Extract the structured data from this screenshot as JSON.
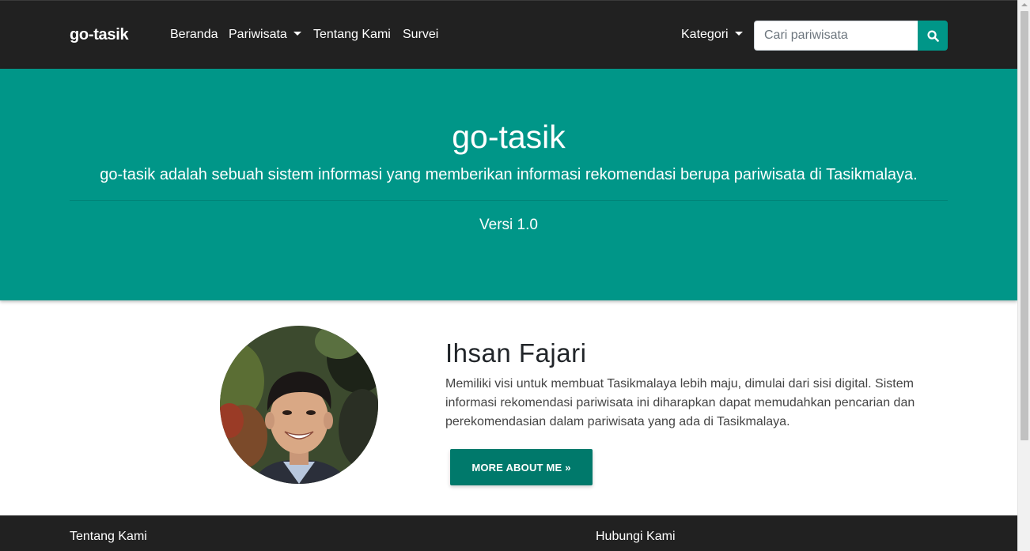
{
  "navbar": {
    "brand": "go-tasik",
    "links": [
      {
        "label": "Beranda"
      },
      {
        "label": "Pariwisata"
      },
      {
        "label": "Tentang Kami"
      },
      {
        "label": "Survei"
      }
    ],
    "category_label": "Kategori",
    "search_placeholder": "Cari pariwisata",
    "search_icon": "search-icon"
  },
  "hero": {
    "title": "go-tasik",
    "description": "go-tasik adalah sebuah sistem informasi yang memberikan informasi rekomendasi berupa pariwisata di Tasikmalaya.",
    "version": "Versi 1.0"
  },
  "profile": {
    "name": "Ihsan Fajari",
    "bio": "Memiliki visi untuk membuat Tasikmalaya lebih maju, dimulai dari sisi digital. Sistem informasi rekomendasi pariwisata ini diharapkan dapat memudahkan pencarian dan perekomendasian dalam pariwisata yang ada di Tasikmalaya.",
    "button_label": "MORE ABOUT ME »"
  },
  "footer": {
    "about_heading": "Tentang Kami",
    "contact_heading": "Hubungi Kami"
  },
  "colors": {
    "primary": "#009688",
    "primary_dark": "#00796b",
    "navbar_bg": "#212121"
  }
}
